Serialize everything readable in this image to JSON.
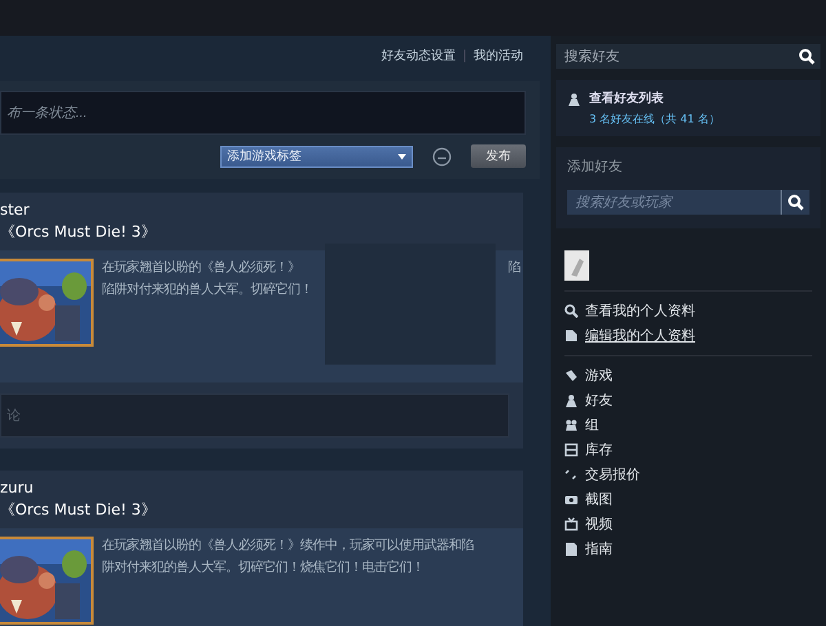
{
  "activity_links": [
    "好友动态设置",
    "我的活动"
  ],
  "link_separator": "|",
  "status": {
    "placeholder": "布一条状态...",
    "tag_dropdown": "添加游戏标签",
    "post_button": "发布"
  },
  "posts": [
    {
      "author": "ster",
      "game": "《Orcs Must Die! 3》",
      "lines": [
        {
          "left": "在玩家翘首以盼的《兽人必须死！》",
          "right": "陷"
        },
        {
          "left": "陷阱对付来犯的兽人大军。切碎它们！"
        }
      ],
      "covered": true,
      "comment_placeholder": "论"
    },
    {
      "author": "zuru",
      "game": "《Orcs Must Die! 3》",
      "lines": [
        {
          "left": "在玩家翘首以盼的《兽人必须死！》续作中，玩家可以使用武器和陷"
        },
        {
          "left": "阱对付来犯的兽人大军。切碎它们！烧焦它们！电击它们！"
        }
      ],
      "covered": false
    }
  ],
  "sidebar": {
    "search_placeholder": "搜索好友",
    "friends_list": "查看好友列表",
    "online": "3 名好友在线（共 41 名）",
    "add_friend": "添加好友",
    "add_placeholder": "搜索好友或玩家",
    "profile_links": [
      {
        "label": "查看我的个人资料",
        "kind": "view"
      },
      {
        "label": "编辑我的个人资料",
        "kind": "edit"
      }
    ],
    "menu": [
      {
        "label": "游戏",
        "kind": "games"
      },
      {
        "label": "好友",
        "kind": "friends"
      },
      {
        "label": "组",
        "kind": "groups"
      },
      {
        "label": "库存",
        "kind": "inventory"
      },
      {
        "label": "交易报价",
        "kind": "trade"
      },
      {
        "label": "截图",
        "kind": "screenshots"
      },
      {
        "label": "视频",
        "kind": "videos"
      },
      {
        "label": "指南",
        "kind": "guides"
      }
    ]
  }
}
